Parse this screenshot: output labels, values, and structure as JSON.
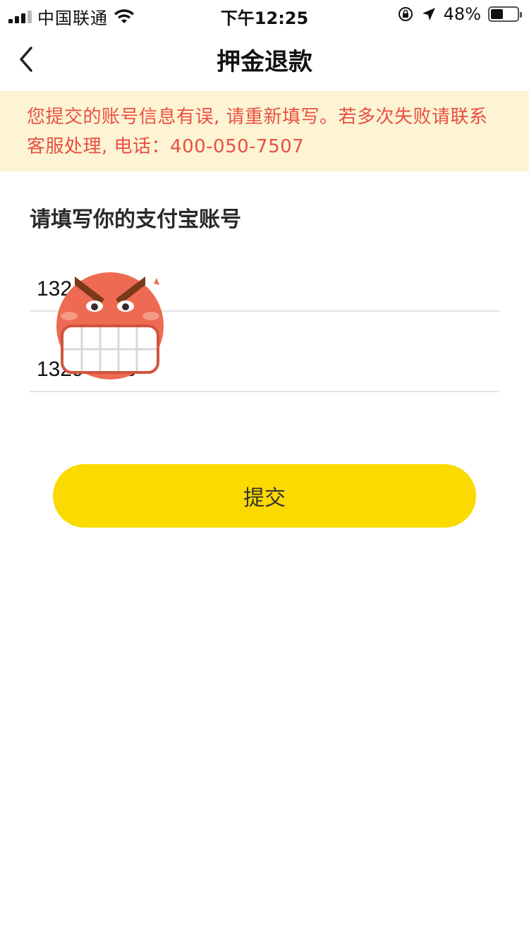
{
  "status_bar": {
    "carrier": "中国联通",
    "time": "下午12:25",
    "battery": "48%",
    "battery_level": 0.48
  },
  "nav": {
    "title": "押金退款",
    "back_icon": "chevron-left-icon"
  },
  "warning": {
    "message": "您提交的账号信息有误, 请重新填写。若多次失败请联系客服处理, 电话：400-050-7507",
    "color": "#ea4f43",
    "background": "#fdf4d4"
  },
  "form": {
    "label": "请填写你的支付宝账号",
    "account_value": "132 050",
    "confirm_value": "1329 0050"
  },
  "submit": {
    "label": "提交",
    "color": "#fbda00"
  }
}
